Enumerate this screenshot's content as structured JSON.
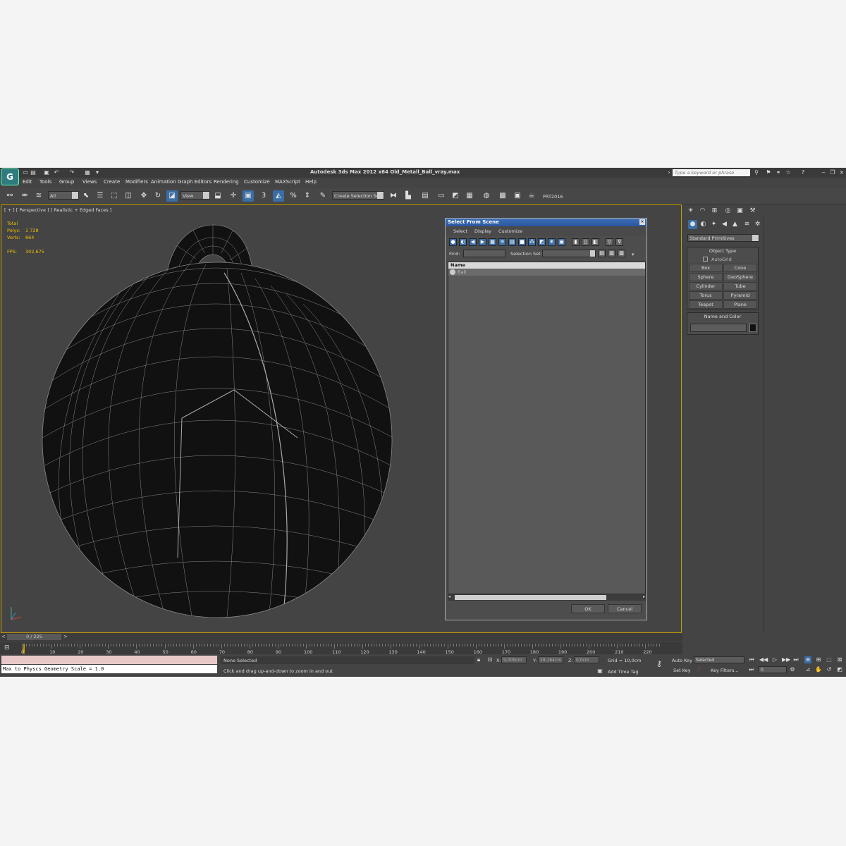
{
  "app": {
    "title": "Autodesk 3ds Max  2012 x64    Old_Metall_Ball_vray.max",
    "search_placeholder": "Type a keyword or phrase",
    "logo": "G"
  },
  "menu": [
    "Edit",
    "Tools",
    "Group",
    "Views",
    "Create",
    "Modifiers",
    "Animation",
    "Graph Editors",
    "Rendering",
    "Customize",
    "MAXScript",
    "Help"
  ],
  "toolbar": {
    "filter_value": "All",
    "refcoord_value": "View",
    "named_selection_value": "Create Selection Se",
    "snap_label": "3",
    "prt_label": "PRT2016"
  },
  "viewport": {
    "label": "[ + ] [ Perspective ] [ Realistic + Edged Faces ]",
    "stats": {
      "total_label": "Total",
      "polys_label": "Polys:",
      "polys_value": "1 728",
      "verts_label": "Verts:",
      "verts_value": "864",
      "fps_label": "FPS:",
      "fps_value": "302,675"
    }
  },
  "dialog": {
    "title": "Select From Scene",
    "menus": [
      "Select",
      "Display",
      "Customize"
    ],
    "find_label": "Find:",
    "selection_set_label": "Selection Set:",
    "column_name": "Name",
    "rows": [
      "Ball"
    ],
    "ok_label": "OK",
    "cancel_label": "Cancel"
  },
  "command_panel": {
    "category_value": "Standard Primitives",
    "object_type_title": "Object Type",
    "autogrid_label": "AutoGrid",
    "primitives": [
      "Box",
      "Cone",
      "Sphere",
      "GeoSphere",
      "Cylinder",
      "Tube",
      "Torus",
      "Pyramid",
      "Teapot",
      "Plane"
    ],
    "name_color_title": "Name and Color",
    "name_value": "",
    "color": "#111111"
  },
  "timeline": {
    "frame_label": "0 / 225",
    "ticks": [
      "0",
      "10",
      "20",
      "30",
      "40",
      "50",
      "60",
      "70",
      "80",
      "90",
      "100",
      "110",
      "120",
      "130",
      "140",
      "150",
      "160",
      "170",
      "180",
      "190",
      "200",
      "210",
      "220"
    ]
  },
  "status": {
    "maxscript_output": "Max to Physcs Geometry Scale = 1.0",
    "selection_status": "None Selected",
    "prompt": "Click and drag up-and-down to zoom in and out",
    "x_label": "X:",
    "x_value": "9,009cm",
    "y_label": "Y:",
    "y_value": "28,164cm",
    "z_label": "Z:",
    "z_value": "0,0cm",
    "grid": "Grid = 10,0cm",
    "add_time_tag": "Add Time Tag",
    "auto_key": "Auto Key",
    "set_key": "Set Key",
    "key_mode_value": "Selected",
    "key_filters": "Key Filters...",
    "frame_value": "0"
  }
}
